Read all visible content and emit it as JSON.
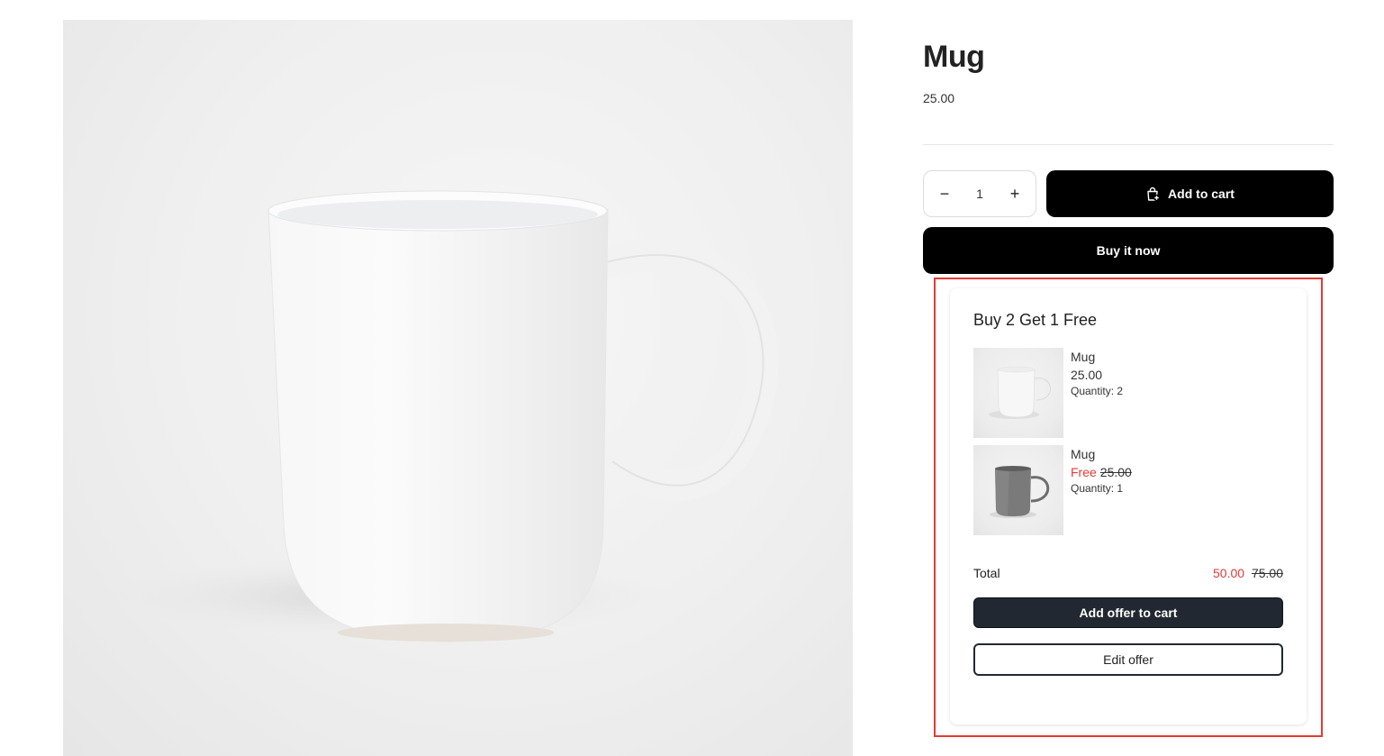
{
  "product": {
    "title": "Mug",
    "price": "25.00",
    "image_icon": "white-mug-photo"
  },
  "quantity": {
    "value": "1",
    "decrease_symbol": "−",
    "increase_symbol": "+"
  },
  "actions": {
    "add_to_cart": "Add to cart",
    "buy_now": "Buy it now"
  },
  "offer": {
    "title": "Buy 2 Get 1 Free",
    "items": [
      {
        "name": "Mug",
        "price": "25.00",
        "quantity": "Quantity: 2",
        "thumb_icon": "white-mug-thumbnail"
      },
      {
        "name": "Mug",
        "free_label": "Free",
        "original_price": "25.00",
        "quantity": "Quantity: 1",
        "thumb_icon": "gray-mug-thumbnail"
      }
    ],
    "total_label": "Total",
    "total_new": "50.00",
    "total_old": "75.00",
    "add_offer_button": "Add offer to cart",
    "edit_offer_button": "Edit offer"
  },
  "colors": {
    "accent_red": "#e53935",
    "button_black": "#000000",
    "offer_button_dark": "#222831"
  }
}
